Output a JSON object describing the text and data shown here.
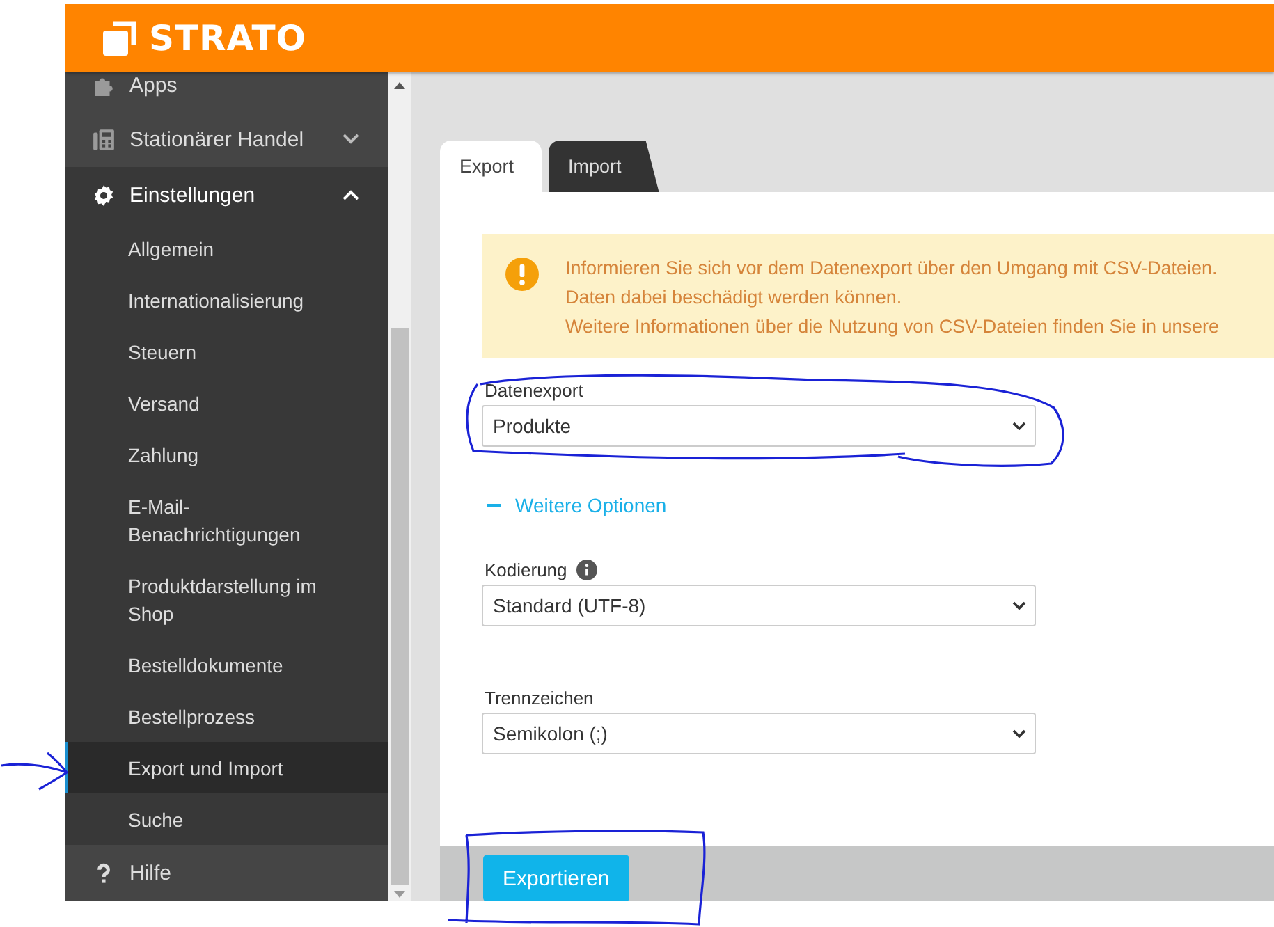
{
  "header": {
    "logo": "STRATO"
  },
  "sidebar": {
    "items": [
      {
        "label": "Apps",
        "kind": "link"
      },
      {
        "label": "Stationärer Handel",
        "kind": "group",
        "expanded": false
      },
      {
        "label": "Einstellungen",
        "kind": "group",
        "expanded": true,
        "children": [
          {
            "label": "Allgemein",
            "selected": false
          },
          {
            "label": "Internationalisierung",
            "selected": false
          },
          {
            "label": "Steuern",
            "selected": false
          },
          {
            "label": "Versand",
            "selected": false
          },
          {
            "label": "Zahlung",
            "selected": false
          },
          {
            "label": "E-Mail-Benachrichtigungen",
            "selected": false
          },
          {
            "label": "Produktdarstellung im Shop",
            "selected": false
          },
          {
            "label": "Bestelldokumente",
            "selected": false
          },
          {
            "label": "Bestellprozess",
            "selected": false
          },
          {
            "label": "Export und Import",
            "selected": true
          },
          {
            "label": "Suche",
            "selected": false
          }
        ]
      },
      {
        "label": "Hilfe",
        "kind": "link"
      }
    ]
  },
  "tabs": [
    {
      "label": "Export",
      "selected": true
    },
    {
      "label": "Import",
      "selected": false
    }
  ],
  "alert": {
    "lines": [
      "Informieren Sie sich vor dem Datenexport über den Umgang mit CSV-Dateien.",
      "Daten dabei beschädigt werden können.",
      "Weitere Informationen über die Nutzung von CSV-Dateien finden Sie in unsere"
    ]
  },
  "fields_top": [
    {
      "label": "Datenexport",
      "value": "Produkte",
      "info": false
    }
  ],
  "options": {
    "label": "Weitere Optionen",
    "expanded": true
  },
  "fields": [
    {
      "label": "Kodierung",
      "value": "Standard (UTF-8)",
      "info": true
    },
    {
      "label": "Trennzeichen",
      "value": "Semikolon (;)",
      "info": false
    }
  ],
  "footer": {
    "button": "Exportieren"
  }
}
